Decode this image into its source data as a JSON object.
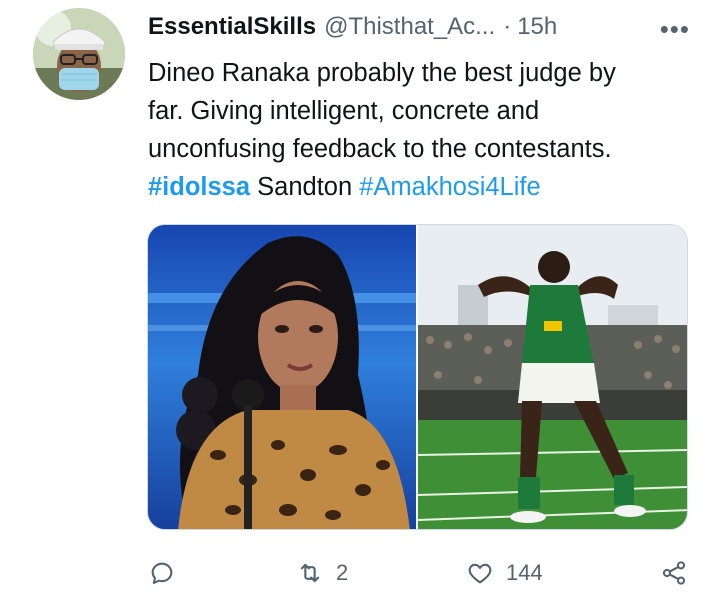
{
  "tweet": {
    "display_name": "EssentialSkills",
    "handle": "@Thisthat_Ac...",
    "separator": "·",
    "time": "15h",
    "more": "•••",
    "text_lines": [
      "Dineo Ranaka probably the best judge by",
      "far. Giving intelligent, concrete and",
      "unconfusing feedback to the contestants."
    ],
    "hashtag_1": "#idolssa",
    "plain_word": " Sandton ",
    "hashtag_2": "#Amakhosi4Life"
  },
  "actions": {
    "reply_count": "",
    "retweet_count": "2",
    "like_count": "144"
  },
  "colors": {
    "link": "#1d9bf0",
    "muted": "#536471",
    "text": "#0f1419"
  },
  "icons": [
    "reply-icon",
    "retweet-icon",
    "like-icon",
    "share-icon",
    "more-icon"
  ]
}
